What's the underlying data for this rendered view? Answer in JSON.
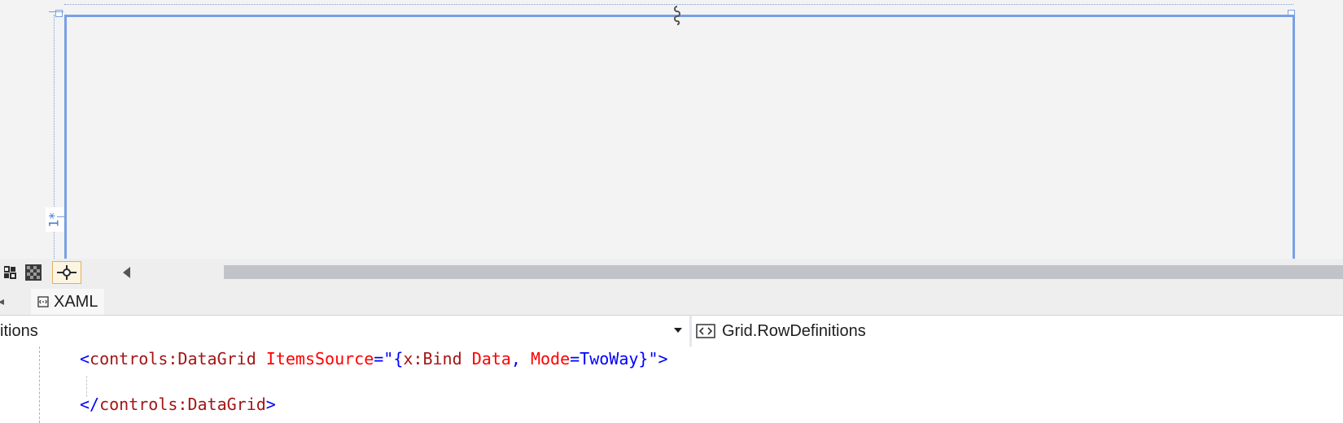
{
  "designer": {
    "row_size_label": "1*"
  },
  "toolbar": {
    "buttons": [
      "layout-grid-icon",
      "checkerboard-icon",
      "snap-points-icon"
    ]
  },
  "tabs": {
    "items": [
      {
        "label": "XAML",
        "icon": "xaml-file-icon"
      }
    ]
  },
  "navbar": {
    "left_text": "itions",
    "right_text": "Grid.RowDefinitions",
    "right_icon": "element-brackets-icon"
  },
  "editor": {
    "line1": {
      "open": "<",
      "element": "controls:DataGrid",
      "attr": "ItemsSource",
      "eq": "=",
      "quote_open": "\"",
      "brace_open": "{",
      "ext_name": "x:Bind",
      "ext_arg": "Data",
      "comma": ",",
      "mode_attr": "Mode",
      "mode_eq": "=",
      "mode_val": "TwoWay",
      "brace_close": "}",
      "quote_close": "\"",
      "close": ">"
    },
    "line2": {
      "open": "</",
      "element": "controls:DataGrid",
      "close": ">"
    },
    "colors": {
      "delimiter": "#0000ff",
      "element": "#a31515",
      "attribute": "#ff0000",
      "value": "#0000ff"
    }
  }
}
